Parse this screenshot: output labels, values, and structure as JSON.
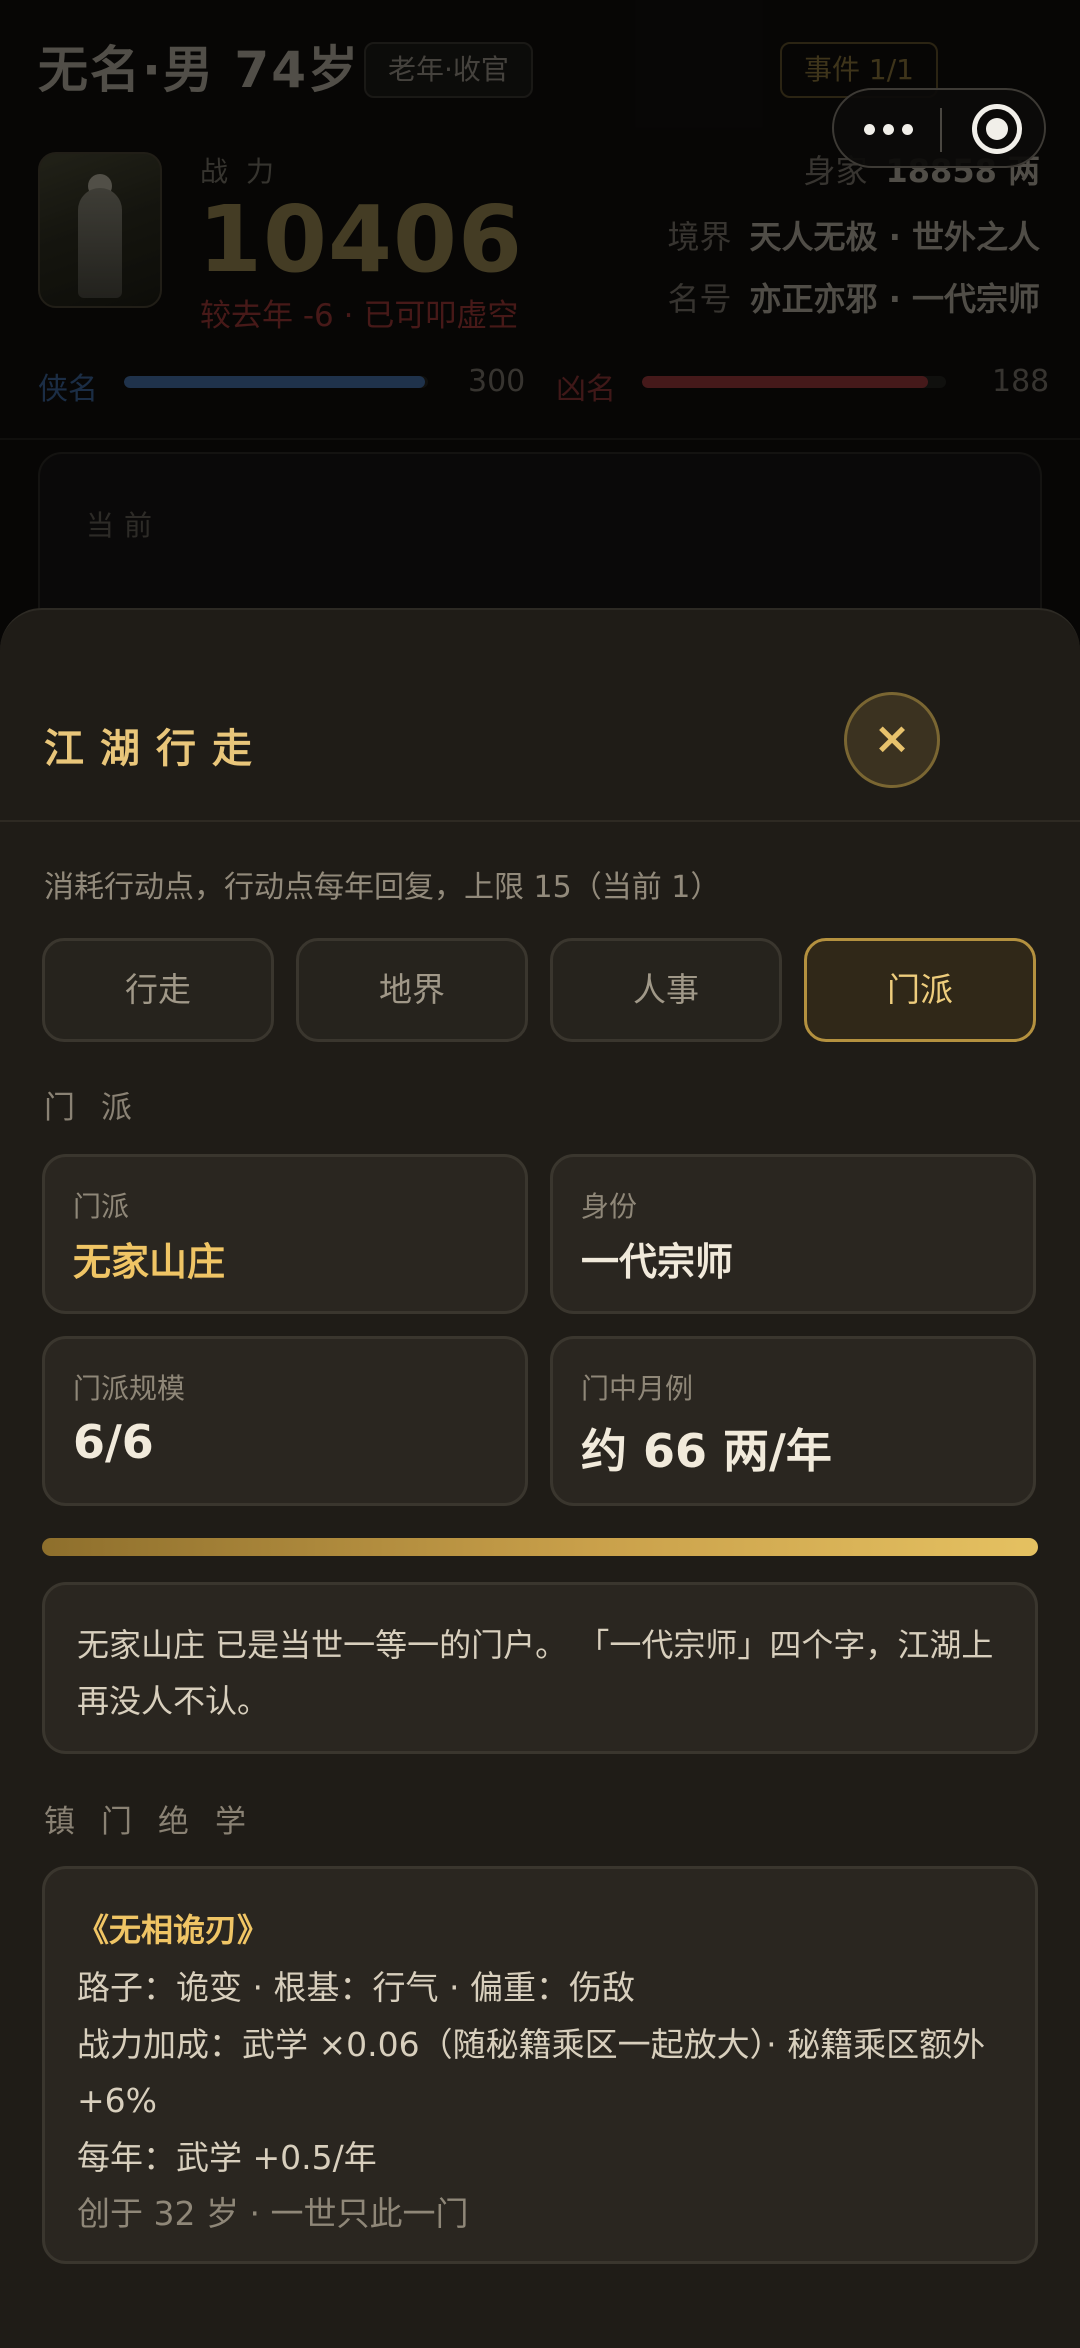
{
  "header": {
    "name": "无名·男 74岁",
    "stage_badge": "老年·收官",
    "event_badge": "事件 1/1",
    "power_label": "战力",
    "power_value": "10406",
    "power_delta": "较去年 -6 · 已可叩虚空",
    "wealth_label": "身家",
    "wealth_value": "18858 两",
    "realm_label": "境界",
    "realm_value": "天人无极 · 世外之人",
    "title_label": "名号",
    "title_value": "亦正亦邪 · 一代宗师",
    "hero_label": "侠名",
    "hero_value": "300",
    "hero_fill": 0.99,
    "villain_label": "凶名",
    "villain_value": "188",
    "villain_fill": 0.94
  },
  "current_card": {
    "label": "当前"
  },
  "sheet": {
    "title": "江湖行走",
    "close_label": "×",
    "hint": "消耗行动点，行动点每年回复，上限 15（当前 1）",
    "tabs": [
      {
        "label": "行走"
      },
      {
        "label": "地界"
      },
      {
        "label": "人事"
      },
      {
        "label": "门派",
        "active": true
      }
    ],
    "section_sect": "门派",
    "cards": [
      {
        "label": "门派",
        "value": "无家山庄"
      },
      {
        "label": "身份",
        "value": "一代宗师"
      },
      {
        "label": "门派规模",
        "value": "6/6"
      },
      {
        "label": "门中月例",
        "value": "约 66 两/年"
      }
    ],
    "sect_progress": 1.0,
    "description": "无家山庄 已是当世一等一的门户。 「一代宗师」四个字，江湖上再没人不认。",
    "section_skill": "镇门绝学",
    "skill": {
      "name": "《无相诡刃》",
      "line1": "路子：诡变 · 根基：行气 · 偏重：伤敌",
      "line2": "战力加成：武学 ×0.06（随秘籍乘区一起放大）· 秘籍乘区额外 +6%",
      "line3": "每年：武学 +0.5/年",
      "line4": "创于 32 岁 · 一世只此一门"
    }
  },
  "colors": {
    "accent_gold": "#e9c67a",
    "hero_blue": "#3f6aa6",
    "villain_red": "#a8363a"
  },
  "icons": [
    "more-dots-icon",
    "target-icon",
    "close-icon"
  ]
}
